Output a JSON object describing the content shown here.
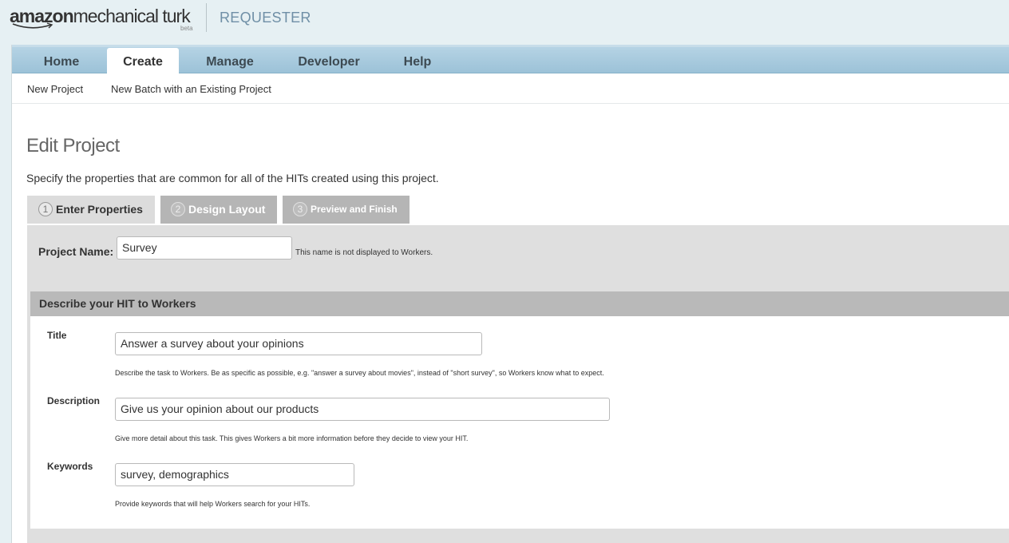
{
  "header": {
    "logo_bold": "amazon",
    "logo_rest": "mechanical turk",
    "logo_badge": "beta",
    "section": "REQUESTER"
  },
  "nav": {
    "tabs": [
      {
        "label": "Home",
        "active": false
      },
      {
        "label": "Create",
        "active": true
      },
      {
        "label": "Manage",
        "active": false
      },
      {
        "label": "Developer",
        "active": false
      },
      {
        "label": "Help",
        "active": false
      }
    ]
  },
  "subnav": {
    "items": [
      "New Project",
      "New Batch with an Existing Project"
    ]
  },
  "page": {
    "title": "Edit Project",
    "intro": "Specify the properties that are common for all of the HITs created using this project."
  },
  "steps": [
    {
      "number": "1",
      "label": "Enter Properties",
      "active": true
    },
    {
      "number": "2",
      "label": "Design Layout",
      "active": false
    },
    {
      "number": "3",
      "label": "Preview and Finish",
      "active": false
    }
  ],
  "project": {
    "label": "Project Name:",
    "value": "Survey",
    "hint": "This name is not displayed to Workers."
  },
  "describe": {
    "heading": "Describe your HIT to Workers",
    "fields": [
      {
        "label": "Title",
        "value": "Answer a survey about your opinions",
        "hint": "Describe the task to Workers. Be as specific as possible, e.g. \"answer a survey about movies\", instead of \"short survey\", so Workers know what to expect."
      },
      {
        "label": "Description",
        "value": "Give us your opinion about our products",
        "hint": "Give more detail about this task. This gives Workers a bit more information before they decide to view your HIT."
      },
      {
        "label": "Keywords",
        "value": "survey, demographics",
        "hint": "Provide keywords that will help Workers search for your HITs."
      }
    ]
  },
  "colors": {
    "nav_blue": "#a9cde2",
    "requester_text": "#6f8fa6",
    "panel_gray": "#dfdfdf",
    "section_header_gray": "#b9b9b9"
  }
}
